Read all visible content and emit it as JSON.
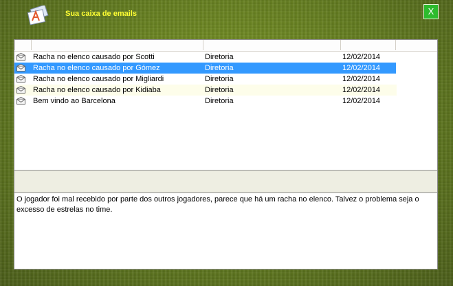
{
  "window": {
    "title": "Sua caixa de emails",
    "close_label": "X"
  },
  "messages": [
    {
      "subject": "Racha no elenco causado por Scotti",
      "sender": "Diretoria",
      "date": "12/02/2014"
    },
    {
      "subject": "Racha no elenco causado por Gómez",
      "sender": "Diretoria",
      "date": "12/02/2014"
    },
    {
      "subject": "Racha no elenco causado por Migliardi",
      "sender": "Diretoria",
      "date": "12/02/2014"
    },
    {
      "subject": "Racha no elenco causado por Kidiaba",
      "sender": "Diretoria",
      "date": "12/02/2014"
    },
    {
      "subject": "Bem vindo ao Barcelona",
      "sender": "Diretoria",
      "date": "12/02/2014"
    }
  ],
  "selected_index": 1,
  "message_body": "O jogador foi mal recebido por parte dos outros jogadores, parece que há um racha no elenco. Talvez o problema seja o excesso de estrelas no time.",
  "colors": {
    "title": "#ffff33",
    "selection": "#3399ff",
    "close_button": "#2dbb2d"
  }
}
